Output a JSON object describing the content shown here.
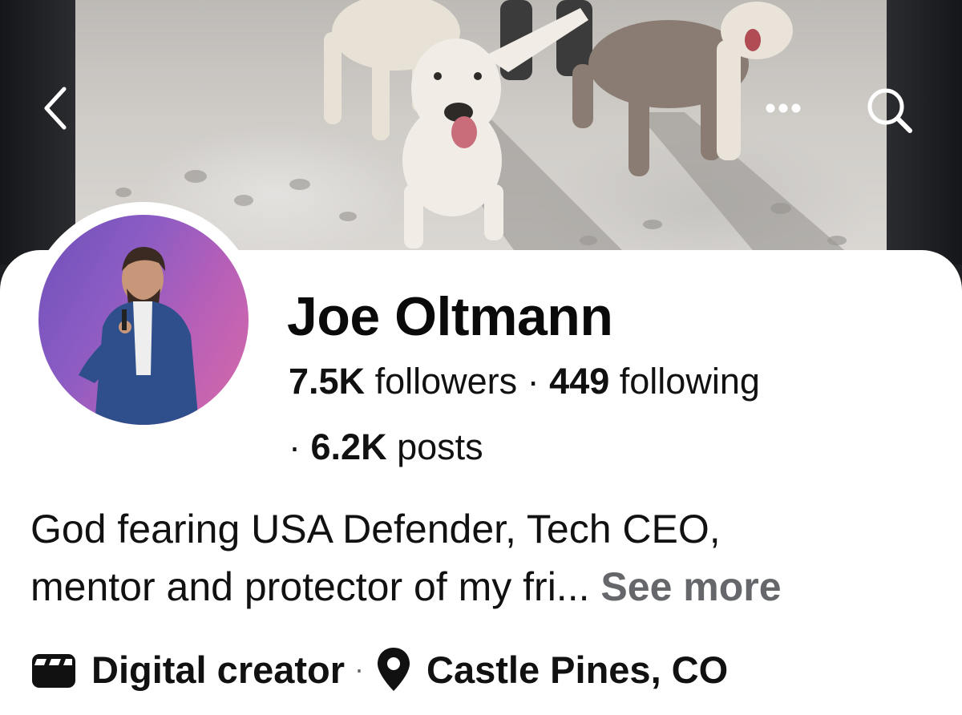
{
  "header": {
    "back_icon": "chevron-left-icon",
    "more_icon": "ellipsis-icon",
    "search_icon": "search-icon"
  },
  "profile": {
    "name": "Joe Oltmann",
    "followers_count": "7.5K",
    "followers_label": "followers",
    "separator": "·",
    "following_count": "449",
    "following_label": "following",
    "posts_separator": "·",
    "posts_count": "6.2K",
    "posts_label": "posts"
  },
  "bio": {
    "line1": "God fearing USA Defender, Tech CEO,",
    "line2": "mentor and protector of my fri...",
    "see_more": "See more"
  },
  "meta": {
    "category_icon": "clapperboard-icon",
    "category": "Digital creator",
    "separator": "·",
    "location_icon": "map-pin-icon",
    "location": "Castle Pines, CO"
  },
  "colors": {
    "text": "#111111",
    "muted": "#65676b",
    "card_bg": "#ffffff",
    "dark_bg": "#1e1f22"
  }
}
